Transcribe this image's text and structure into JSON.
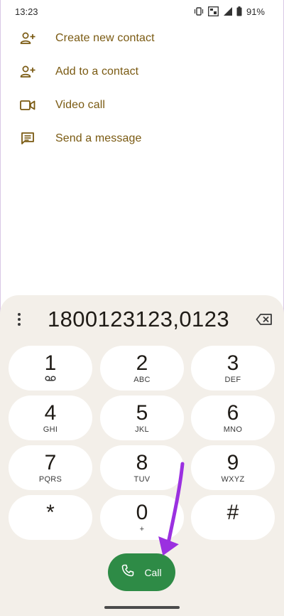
{
  "status_bar": {
    "time": "13:23",
    "battery": "91%",
    "icons": [
      "vibrate-icon",
      "volte-icon",
      "signal-icon",
      "battery-icon"
    ]
  },
  "actions": [
    {
      "label": "Create new contact",
      "icon": "person-add-icon"
    },
    {
      "label": "Add to a contact",
      "icon": "person-add-icon"
    },
    {
      "label": "Video call",
      "icon": "video-camera-icon"
    },
    {
      "label": "Send a message",
      "icon": "message-icon"
    }
  ],
  "dialer": {
    "number": "1800123123,0123",
    "keys": [
      {
        "digit": "1",
        "letters": "",
        "icon": "voicemail-icon"
      },
      {
        "digit": "2",
        "letters": "ABC"
      },
      {
        "digit": "3",
        "letters": "DEF"
      },
      {
        "digit": "4",
        "letters": "GHI"
      },
      {
        "digit": "5",
        "letters": "JKL"
      },
      {
        "digit": "6",
        "letters": "MNO"
      },
      {
        "digit": "7",
        "letters": "PQRS"
      },
      {
        "digit": "8",
        "letters": "TUV"
      },
      {
        "digit": "9",
        "letters": "WXYZ"
      },
      {
        "digit": "*",
        "letters": ""
      },
      {
        "digit": "0",
        "letters": "+"
      },
      {
        "digit": "#",
        "letters": ""
      }
    ],
    "call_label": "Call"
  },
  "colors": {
    "accent_text": "#7a5a12",
    "call_green": "#2e8b46",
    "annotation_arrow": "#9b30e0",
    "dialpad_bg": "#f3efe9"
  }
}
